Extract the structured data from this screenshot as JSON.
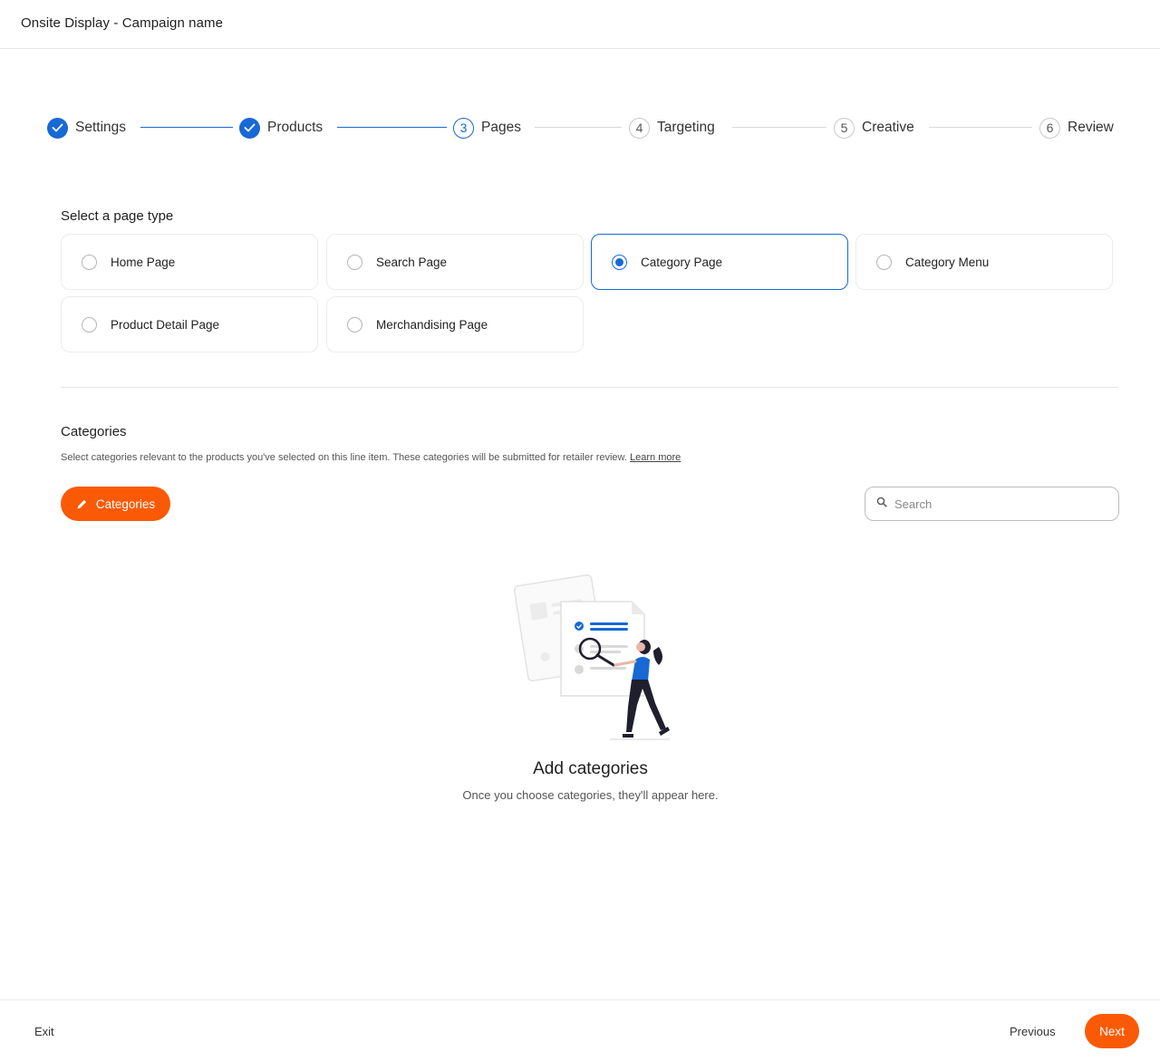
{
  "header": {
    "title": "Onsite Display - Campaign name"
  },
  "stepper": {
    "steps": [
      {
        "number": "1",
        "label": "Settings",
        "state": "done"
      },
      {
        "number": "2",
        "label": "Products",
        "state": "done"
      },
      {
        "number": "3",
        "label": "Pages",
        "state": "current"
      },
      {
        "number": "4",
        "label": "Targeting",
        "state": "todo"
      },
      {
        "number": "5",
        "label": "Creative",
        "state": "todo"
      },
      {
        "number": "6",
        "label": "Review",
        "state": "todo"
      }
    ]
  },
  "page_type": {
    "title": "Select a page type",
    "selected": "Category Page",
    "options": [
      {
        "label": "Home Page",
        "selected": false
      },
      {
        "label": "Search Page",
        "selected": false
      },
      {
        "label": "Category Page",
        "selected": true
      },
      {
        "label": "Category Menu",
        "selected": false
      },
      {
        "label": "Product Detail Page",
        "selected": false
      },
      {
        "label": "Merchandising Page",
        "selected": false
      }
    ]
  },
  "categories": {
    "title": "Categories",
    "description": "Select categories relevant to the products you've selected on this line item. These categories will be submitted for retailer review.",
    "learn_more": "Learn more",
    "button_label": "Categories",
    "search_placeholder": "Search",
    "empty_title": "Add categories",
    "empty_subtitle": "Once you choose categories, they'll appear here."
  },
  "footer": {
    "exit_label": "Exit",
    "previous_label": "Previous",
    "next_label": "Next"
  },
  "colors": {
    "accent": "#1769d4",
    "primary_button": "#fa5a05"
  }
}
